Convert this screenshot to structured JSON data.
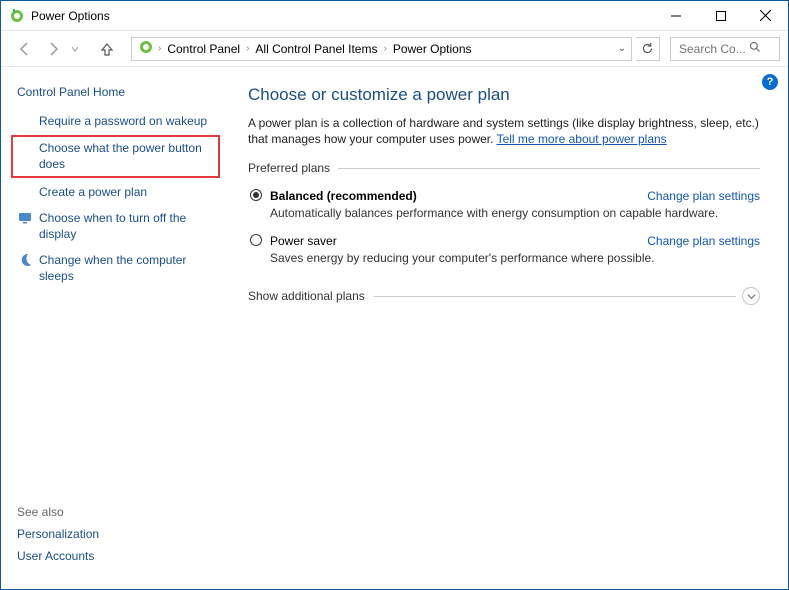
{
  "window": {
    "title": "Power Options"
  },
  "breadcrumbs": {
    "items": [
      "Control Panel",
      "All Control Panel Items",
      "Power Options"
    ]
  },
  "search": {
    "placeholder": "Search Co..."
  },
  "sidebar": {
    "home": "Control Panel Home",
    "items": [
      {
        "label": "Require a password on wakeup"
      },
      {
        "label": "Choose what the power button does",
        "highlighted": true
      },
      {
        "label": "Create a power plan"
      },
      {
        "label": "Choose when to turn off the display",
        "icon": "display-icon"
      },
      {
        "label": "Change when the computer sleeps",
        "icon": "moon-icon"
      }
    ],
    "see_also_head": "See also",
    "see_also": [
      "Personalization",
      "User Accounts"
    ]
  },
  "main": {
    "heading": "Choose or customize a power plan",
    "desc_prefix": "A power plan is a collection of hardware and system settings (like display brightness, sleep, etc.) that manages how your computer uses power. ",
    "desc_link": "Tell me more about power plans",
    "preferred_label": "Preferred plans",
    "change_settings": "Change plan settings",
    "plans": [
      {
        "name": "Balanced (recommended)",
        "selected": true,
        "desc": "Automatically balances performance with energy consumption on capable hardware."
      },
      {
        "name": "Power saver",
        "selected": false,
        "desc": "Saves energy by reducing your computer's performance where possible."
      }
    ],
    "show_more": "Show additional plans"
  },
  "help": "?"
}
